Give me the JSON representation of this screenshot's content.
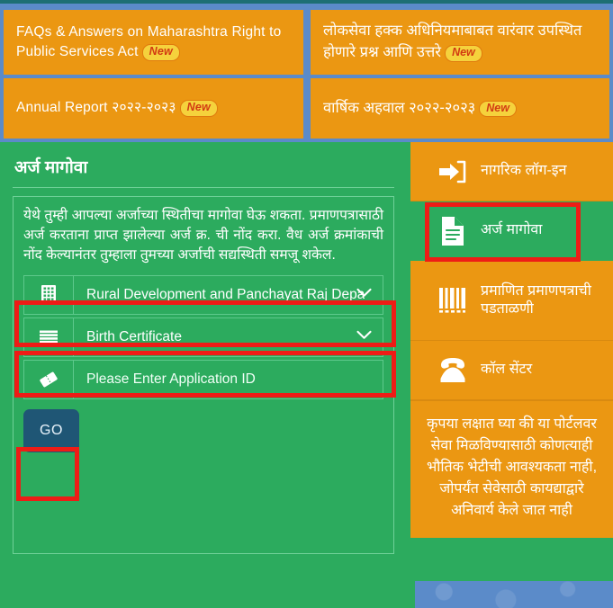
{
  "theme": {
    "blue_bg": "#5b8bc9",
    "orange": "#eb9712",
    "green": "#2cab5e",
    "navy_button": "#1f5675",
    "annotation_red": "#ee1c16",
    "badge_bg": "#f5d23c",
    "badge_text": "#d23a12"
  },
  "announcements": [
    {
      "text": "FAQs & Answers on Maharashtra Right to Public Services Act",
      "badge": "New",
      "lang": "en"
    },
    {
      "text": "लोकसेवा हक्क अधिनियमाबाबत वारंवार उपस्थित होणारे प्रश्न आणि उत्तरे",
      "badge": "New",
      "lang": "mr"
    },
    {
      "text": "Annual Report २०२२-२०२३",
      "badge": "New",
      "lang": "en"
    },
    {
      "text": "वार्षिक अहवाल २०२२-२०२३",
      "badge": "New",
      "lang": "mr"
    }
  ],
  "track_panel": {
    "title": "अर्ज मागोवा",
    "description": "येथे तुम्ही आपल्या अर्जाच्या स्थितीचा मागोवा घेऊ शकता. प्रमाणपत्रासाठी अर्ज करताना प्राप्त झालेल्या अर्ज क्र. ची नोंद करा. वैध अर्ज क्रमांकाची नोंद केल्यानंतर तुम्हाला तुमच्या अर्जाची सद्यस्थिती समजू शकेल.",
    "fields": [
      {
        "name": "department",
        "icon": "building-icon",
        "value": "Rural Development and Panchayat Raj Depa",
        "type": "select"
      },
      {
        "name": "service",
        "icon": "list-icon",
        "value": "Birth Certificate",
        "type": "select"
      },
      {
        "name": "application_id",
        "icon": "ticket-icon",
        "placeholder": "Please Enter Application ID",
        "value": "",
        "type": "text"
      }
    ],
    "submit_label": "GO"
  },
  "side_menu": {
    "items": [
      {
        "label": "नागरिक लॉग-इन",
        "icon": "sign-in-icon",
        "active": false
      },
      {
        "label": "अर्ज मागोवा",
        "icon": "document-icon",
        "active": true
      },
      {
        "label": "प्रमाणित प्रमाणपत्राची पडताळणी",
        "icon": "barcode-icon",
        "active": false
      },
      {
        "label": "कॉल सेंटर",
        "icon": "telephone-icon",
        "active": false
      }
    ],
    "notice": "कृपया लक्षात घ्या की या पोर्टलवर सेवा मिळविण्यासाठी कोणत्याही भौतिक भेटीची आवश्यकता नाही, जोपर्यंत सेवेसाठी कायद्याद्वारे अनिवार्य केले जात नाही"
  }
}
